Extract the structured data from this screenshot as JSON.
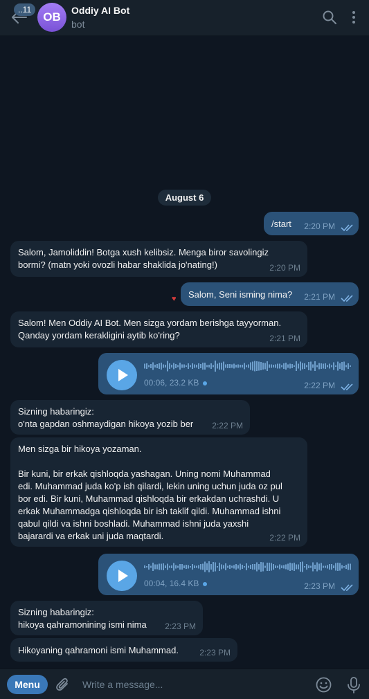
{
  "header": {
    "unread": "..11",
    "avatar_initials": "OB",
    "title": "Oddiy AI Bot",
    "subtitle": "bot"
  },
  "date_separator": "August 6",
  "messages": [
    {
      "dir": "out",
      "text": "/start",
      "time": "2:20 PM"
    },
    {
      "dir": "in",
      "text": "Salom, Jamoliddin! Botga xush kelibsiz. Menga biror savolingiz\nbormi? (matn yoki ovozli habar shaklida jo'nating!)",
      "time": "2:20 PM"
    },
    {
      "dir": "out",
      "text": "Salom, Seni isming nima?",
      "time": "2:21 PM"
    },
    {
      "dir": "in",
      "text": "Salom! Men Oddiy AI Bot. Men sizga yordam berishga tayyorman.\nQanday yordam kerakligini aytib ko'ring?",
      "time": "2:21 PM"
    },
    {
      "dir": "out",
      "type": "voice",
      "duration": "00:06, 23.2 KB",
      "time": "2:22 PM"
    },
    {
      "dir": "in",
      "text": "Sizning habaringiz:\no'nta gapdan oshmaydigan hikoya yozib ber",
      "time": "2:22 PM"
    },
    {
      "dir": "in",
      "text": "Men sizga bir hikoya yozaman.\n\nBir kuni, bir erkak qishloqda yashagan. Uning nomi Muhammad\nedi. Muhammad juda ko'p ish qilardi, lekin uning uchun juda oz pul\nbor edi. Bir kuni, Muhammad qishloqda bir erkakdan uchrashdi. U\nerkak Muhammadga qishloqda bir ish taklif qildi. Muhammad ishni\nqabul qildi va ishni boshladi. Muhammad ishni juda yaxshi\nbajarardi va erkak uni juda maqtardi.",
      "time": "2:22 PM"
    },
    {
      "dir": "out",
      "type": "voice",
      "duration": "00:04, 16.4 KB",
      "time": "2:23 PM"
    },
    {
      "dir": "in",
      "text": "Sizning habaringiz:\nhikoya qahramonining ismi nima",
      "time": "2:23 PM"
    },
    {
      "dir": "in",
      "text": "Hikoyaning qahramoni ismi Muhammad.",
      "time": "2:23 PM"
    }
  ],
  "input": {
    "menu_label": "Menu",
    "placeholder": "Write a message..."
  },
  "colors": {
    "background": "#0e1621",
    "incoming": "#182533",
    "outgoing": "#2b5278",
    "accent": "#5aa6e6"
  },
  "icons": [
    "back-arrow-icon",
    "search-icon",
    "more-vertical-icon",
    "play-icon",
    "double-check-icon",
    "heart-icon",
    "attach-icon",
    "emoji-icon",
    "microphone-icon"
  ]
}
